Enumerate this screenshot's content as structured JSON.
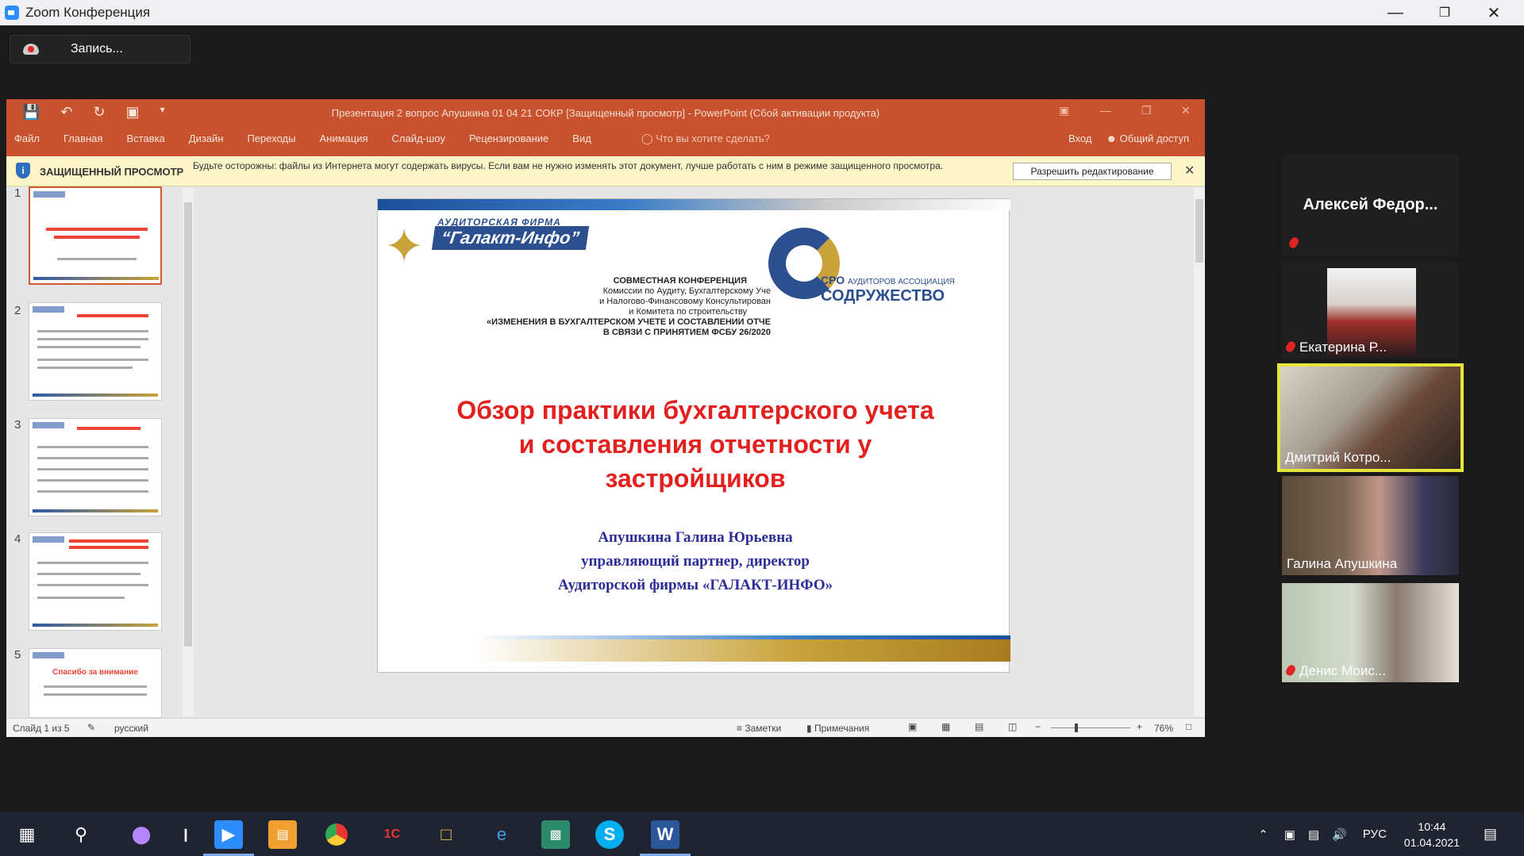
{
  "zoom": {
    "window_title": "Zoom Конференция",
    "record_label": "Запись..."
  },
  "ppt": {
    "title": "Презентация 2 вопрос Апушкина 01 04 21 СОКР [Защищенный просмотр] - PowerPoint (Сбой активации продукта)",
    "tabs": [
      "Файл",
      "Главная",
      "Вставка",
      "Дизайн",
      "Переходы",
      "Анимация",
      "Слайд-шоу",
      "Рецензирование",
      "Вид"
    ],
    "tell_me": "Что вы хотите сделать?",
    "signin": "Вход",
    "share": "Общий доступ",
    "protected_label": "ЗАЩИЩЕННЫЙ ПРОСМОТР",
    "protected_msg": "Будьте осторожны: файлы из Интернета могут содержать вирусы. Если вам не нужно изменять этот документ, лучше работать с ним в режиме защищенного просмотра.",
    "enable_editing": "Разрешить редактирование",
    "thumb_numbers": [
      "1",
      "2",
      "3",
      "4",
      "5"
    ],
    "thumb5_title": "Спасибо за внимание",
    "status": {
      "slide": "Слайд 1 из 5",
      "lang": "русский",
      "notes": "Заметки",
      "comments": "Примечания",
      "zoom": "76%"
    }
  },
  "slide": {
    "audit_label": "АУДИТОРСКАЯ ФИРМА",
    "brand": "“Галакт-Инфо”",
    "conf_lines": [
      "СОВМЕСТНАЯ КОНФЕРЕНЦИЯ",
      "Комиссии по Аудиту, Бухгалтерскому Уче",
      "и Налогово-Финансовому Консультирован",
      "и Комитета по строительству",
      "«ИЗМЕНЕНИЯ В БУХГАЛТЕРСКОМ УЧЕТЕ И СОСТАВЛЕНИИ ОТЧЕ",
      "В СВЯЗИ С ПРИНЯТИЕМ ФСБУ 26/2020"
    ],
    "sro_line1": "СРО",
    "sro_line1b": "АУДИТОРОВ АССОЦИАЦИЯ",
    "sro_line2": "СОДРУЖЕСТВО",
    "title_lines": [
      "Обзор практики бухгалтерского учета",
      "и составления отчетности у",
      "застройщиков"
    ],
    "author_lines": [
      "Апушкина Галина Юрьевна",
      "управляющий партнер, директор",
      "Аудиторской фирмы «ГАЛАКТ-ИНФО»"
    ]
  },
  "participants": [
    {
      "name": "Алексей Федор...",
      "muted": true
    },
    {
      "name": "Екатерина Р...",
      "muted": true
    },
    {
      "name": "Дмитрий Котро...",
      "muted": false,
      "active": true
    },
    {
      "name": "Галина Апушкина",
      "muted": false
    },
    {
      "name": "Денис Моис...",
      "muted": true
    }
  ],
  "taskbar": {
    "lang": "РУС",
    "time": "10:44",
    "date": "01.04.2021"
  },
  "colors": {
    "ppt_accent": "#c8522d",
    "active_speaker": "#e6e63a",
    "slide_title": "#e4201f",
    "slide_author": "#2d2d9a"
  }
}
